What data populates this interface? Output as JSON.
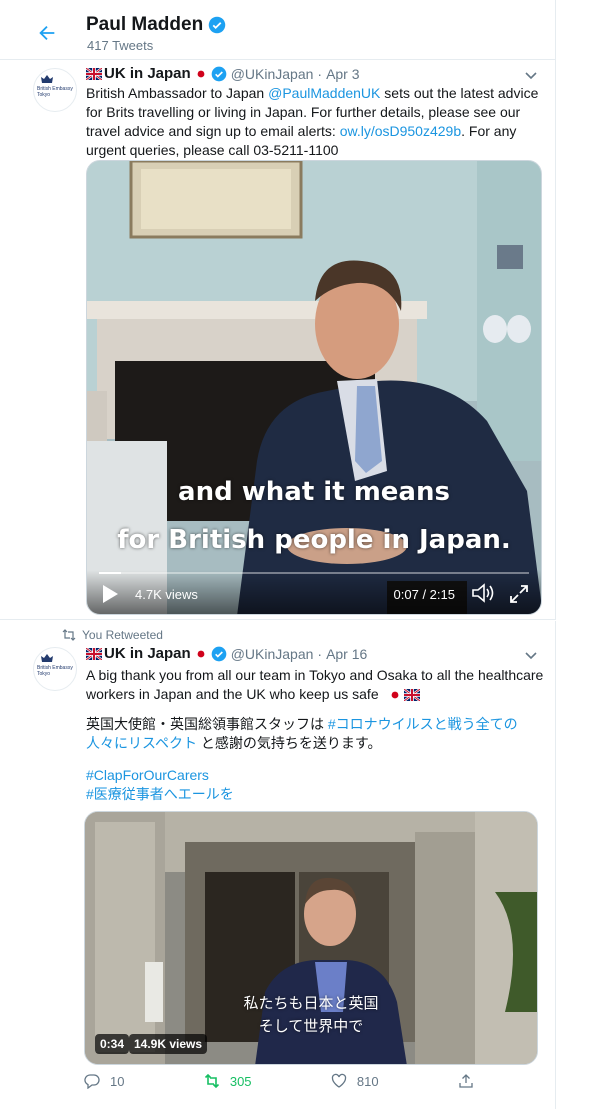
{
  "header": {
    "name": "Paul Madden",
    "tweets_count": "417 Tweets"
  },
  "colors": {
    "accent": "#1da1f2",
    "link": "#1b95e0",
    "retweet_green": "#17bf63",
    "muted": "#657786"
  },
  "tweets": [
    {
      "author": "UK in Japan",
      "handle": "@UKinJapan",
      "date": "Apr 3",
      "avatar_text": "British Embassy Tokyo",
      "text_parts": {
        "a": "British Ambassador to Japan ",
        "mention": "@PaulMaddenUK",
        "b": " sets out the latest advice for Brits travelling or living in Japan. For further details, please see our travel advice and sign up to email alerts: ",
        "url": "ow.ly/osD950z429b",
        "c": ". For any urgent queries, please call 03-5211-1100"
      },
      "video": {
        "caption_line1": "and what it means",
        "caption_line2": "for British people in Japan.",
        "views": "4.7K views",
        "time": "0:07 / 2:15",
        "progress": 0.05
      }
    },
    {
      "retweet_note": "You Retweeted",
      "author": "UK in Japan",
      "handle": "@UKinJapan",
      "date": "Apr 16",
      "avatar_text": "British Embassy Tokyo",
      "text_line1": "A big thank you from all our team in Tokyo and Osaka to all the healthcare workers in Japan and the UK who keep us safe",
      "jp_text_a": "英国大使館・英国総領事館スタッフは ",
      "jp_hashtag": "#コロナウイルスと戦う全ての人々にリスペクト",
      "jp_text_b": " と感謝の気持ちを送ります。",
      "hashtag1": "#ClapForOurCarers",
      "hashtag2": "#医療従事者へエールを",
      "video": {
        "caption_line1": "私たちも日本と英国",
        "caption_line2": "そして世界中で",
        "duration": "0:34",
        "views": "14.9K views"
      },
      "actions": {
        "replies": "10",
        "retweets": "305",
        "likes": "810"
      }
    }
  ]
}
